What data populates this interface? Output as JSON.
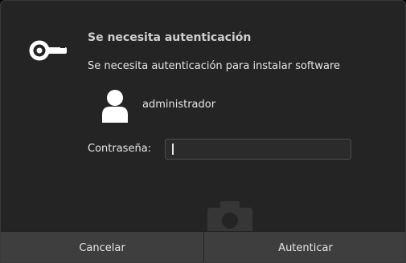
{
  "dialog": {
    "title": "Se necesita autenticación",
    "message": "Se necesita autenticación para instalar software",
    "key_icon": "key-icon",
    "user": {
      "icon": "user-icon",
      "name": "administrador"
    },
    "password": {
      "label": "Contraseña:",
      "value": ""
    }
  },
  "buttons": {
    "cancel": "Cancelar",
    "authenticate": "Autenticar"
  }
}
